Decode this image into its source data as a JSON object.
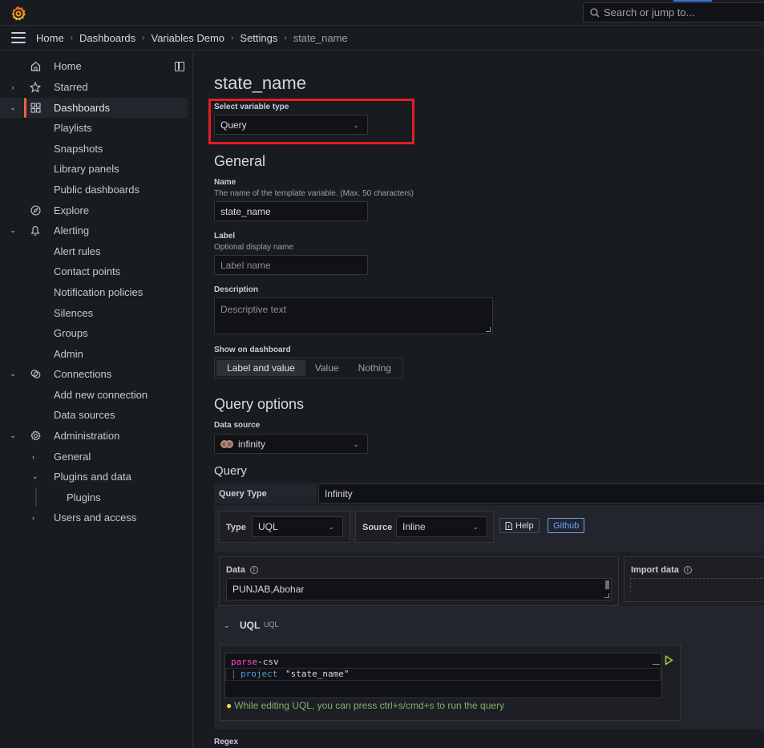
{
  "topbar": {
    "search_placeholder": "Search or jump to..."
  },
  "breadcrumb": {
    "items": [
      "Home",
      "Dashboards",
      "Variables Demo",
      "Settings",
      "state_name"
    ]
  },
  "sidebar": {
    "items": [
      {
        "label": "Home",
        "icon": "home-icon"
      },
      {
        "label": "Starred",
        "icon": "star-icon"
      },
      {
        "label": "Dashboards",
        "icon": "apps-icon",
        "active": true
      },
      {
        "label": "Playlists"
      },
      {
        "label": "Snapshots"
      },
      {
        "label": "Library panels"
      },
      {
        "label": "Public dashboards"
      },
      {
        "label": "Explore",
        "icon": "compass-icon"
      },
      {
        "label": "Alerting",
        "icon": "bell-icon"
      },
      {
        "label": "Alert rules"
      },
      {
        "label": "Contact points"
      },
      {
        "label": "Notification policies"
      },
      {
        "label": "Silences"
      },
      {
        "label": "Groups"
      },
      {
        "label": "Admin"
      },
      {
        "label": "Connections",
        "icon": "connections-icon"
      },
      {
        "label": "Add new connection"
      },
      {
        "label": "Data sources"
      },
      {
        "label": "Administration",
        "icon": "cog-icon"
      },
      {
        "label": "General"
      },
      {
        "label": "Plugins and data"
      },
      {
        "label": "Plugins"
      },
      {
        "label": "Users and access"
      }
    ]
  },
  "page": {
    "title": "state_name",
    "variable_type": {
      "label": "Select variable type",
      "value": "Query"
    },
    "general": {
      "heading": "General",
      "name": {
        "label": "Name",
        "description": "The name of the template variable. (Max. 50 characters)",
        "value": "state_name"
      },
      "label_field": {
        "label": "Label",
        "description": "Optional display name",
        "placeholder": "Label name"
      },
      "description_field": {
        "label": "Description",
        "placeholder": "Descriptive text"
      },
      "show_on_dashboard": {
        "label": "Show on dashboard",
        "options": [
          "Label and value",
          "Value",
          "Nothing"
        ],
        "selected": "Label and value"
      }
    },
    "query_options": {
      "heading": "Query options",
      "data_source": {
        "label": "Data source",
        "value": "infinity"
      },
      "query_heading": "Query",
      "query_type": {
        "label": "Query Type",
        "value": "Infinity"
      },
      "type": {
        "label": "Type",
        "value": "UQL"
      },
      "source": {
        "label": "Source",
        "value": "Inline"
      },
      "help_button": "Help",
      "github_button": "Github",
      "data": {
        "label": "Data",
        "value": "PUNJAB,Abohar"
      },
      "import_data": {
        "label": "Import data"
      },
      "uql": {
        "title": "UQL",
        "subtitle": "UQL",
        "line1_keyword": "parse",
        "line1_rest": "-csv",
        "line2_pipe": "|",
        "line2_keyword": "project",
        "line2_string": "\"state_name\"",
        "tip": "While editing UQL, you can press ctrl+s/cmd+s to run the query"
      },
      "regex_label": "Regex"
    }
  }
}
